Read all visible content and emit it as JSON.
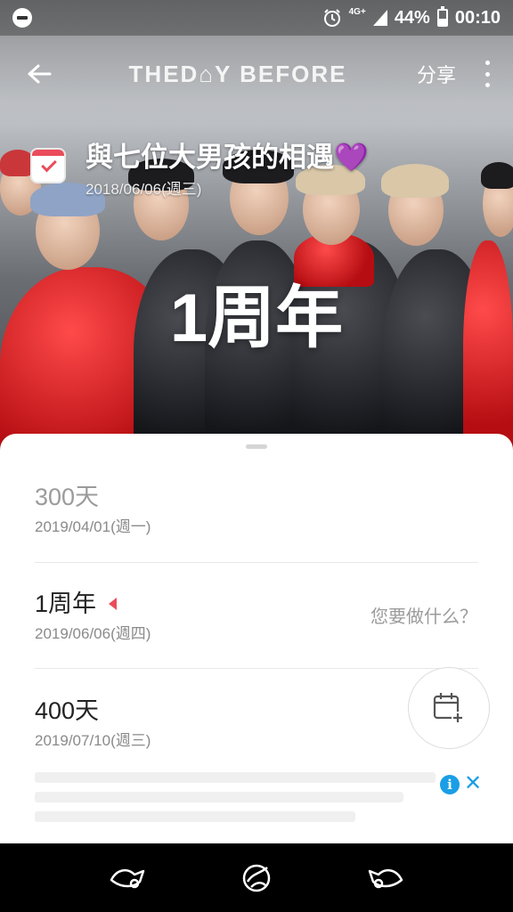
{
  "status_bar": {
    "network": "4G+",
    "battery": "44%",
    "time": "00:10"
  },
  "header": {
    "logo": "THED⌂Y BEFORE",
    "share_label": "分享"
  },
  "event": {
    "title": "與七位大男孩的相遇",
    "emoji": "💜",
    "date": "2018/06/06(週三)",
    "milestone_big": "1周年"
  },
  "milestones": [
    {
      "title": "300天",
      "date": "2019/04/01(週一)"
    },
    {
      "title": "1周年",
      "date": "2019/06/06(週四)",
      "action_prompt": "您要做什么？"
    },
    {
      "title": "400天",
      "date": "2019/07/10(週三)"
    }
  ],
  "ad": {
    "info_glyph": "i",
    "close_glyph": "✕"
  },
  "colors": {
    "accent": "#ea4c5b",
    "ad_blue": "#1a9ee6",
    "heart": "#8a2be2"
  },
  "icons": {
    "status": [
      "dnd-icon",
      "alarm-icon",
      "signal-icon",
      "battery-icon"
    ],
    "header": [
      "back-arrow-icon",
      "more-vert-icon"
    ],
    "fab": "calendar-add-icon",
    "nav": [
      "nav-back-icon",
      "nav-home-icon",
      "nav-recent-icon"
    ]
  }
}
